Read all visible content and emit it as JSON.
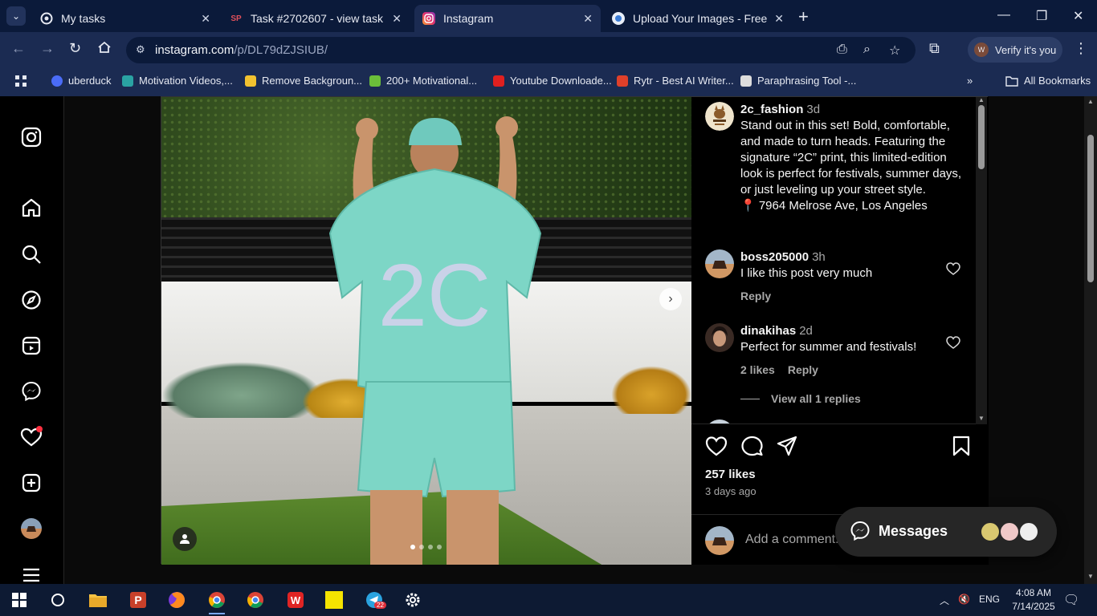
{
  "browser": {
    "tabs": [
      {
        "title": "My tasks",
        "icon": "my-tasks-icon",
        "active": false
      },
      {
        "title": "Task #2702607 - view task",
        "icon": "sp-icon",
        "icon_text": "SP",
        "active": false
      },
      {
        "title": "Instagram",
        "icon": "instagram-icon",
        "active": true
      },
      {
        "title": "Upload Your Images - Free Imag",
        "icon": "image-upload-icon",
        "active": false
      }
    ],
    "url_host": "instagram.com",
    "url_path": "/p/DL79dZJSIUB/",
    "profile_label": "Verify it's you",
    "bookmarks": [
      {
        "label": "uberduck",
        "color": "#4a6cf7"
      },
      {
        "label": "Motivation Videos,...",
        "color": "#2aa3a3"
      },
      {
        "label": "Remove Backgroun...",
        "color": "#f2c230"
      },
      {
        "label": "200+ Motivational...",
        "color": "#6bbf3a"
      },
      {
        "label": "Youtube Downloade...",
        "color": "#e02020"
      },
      {
        "label": "Rytr - Best AI Writer...",
        "color": "#e0402a"
      },
      {
        "label": "Paraphrasing Tool -...",
        "color": "#dddddd"
      }
    ],
    "all_bookmarks": "All Bookmarks"
  },
  "post": {
    "caption": {
      "user": "2c_fashion",
      "time": "3d",
      "text": "Stand out in this set! Bold, comfortable, and made to turn heads. Featuring the signature “2C” print, this limited-edition look is perfect for festivals, summer days, or just leveling up your street style.",
      "location": "📍 7964 Melrose Ave, Los Angeles"
    },
    "comments": [
      {
        "user": "boss205000",
        "time": "3h",
        "text": "I like this post very much",
        "likes": "",
        "reply": "Reply"
      },
      {
        "user": "dinakihas",
        "time": "2d",
        "text": "Perfect for summer and festivals!",
        "likes": "2 likes",
        "reply": "Reply"
      }
    ],
    "view_replies": "View all 1 replies",
    "likes": "257 likes",
    "posted": "3 days ago",
    "add_comment_placeholder": "Add a comment...",
    "image_shirt_text": "2C",
    "carousel": {
      "total": 4,
      "current": 1
    }
  },
  "messages": {
    "label": "Messages"
  },
  "taskbar": {
    "lang": "ENG",
    "time": "4:08 AM",
    "date": "7/14/2025",
    "telegram_badge": "22"
  }
}
